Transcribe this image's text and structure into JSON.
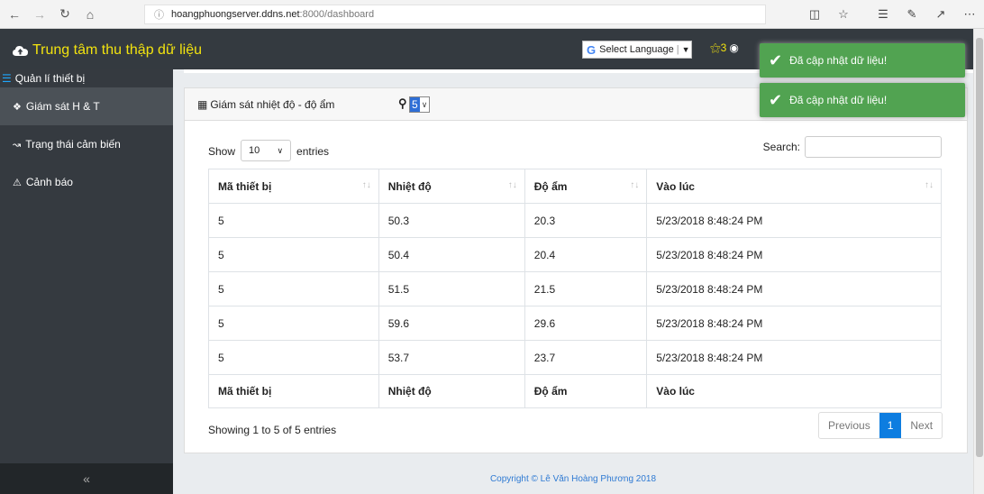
{
  "browser": {
    "url_host": "hoangphuongserver.ddns.net",
    "url_path": ":8000/dashboard"
  },
  "header": {
    "brand": "Trung tâm thu thập dữ liệu",
    "language_label": "Select Language",
    "user_count": "3"
  },
  "sidebar": {
    "section_title": "Quản lí thiết bị",
    "items": [
      {
        "label": "Giám sát H & T"
      },
      {
        "label": "Trạng thái cảm biến"
      },
      {
        "label": "Cảnh báo"
      }
    ],
    "collapse_label": "«"
  },
  "card": {
    "title": "Giám sát nhiệt độ - độ ẩm",
    "device_select_value": "5"
  },
  "table_controls": {
    "show_label": "Show",
    "entries_value": "10",
    "entries_label": "entries",
    "search_label": "Search:"
  },
  "table": {
    "headers": [
      "Mã thiết bị",
      "Nhiệt độ",
      "Độ ẩm",
      "Vào lúc"
    ],
    "rows": [
      [
        "5",
        "50.3",
        "20.3",
        "5/23/2018 8:48:24 PM"
      ],
      [
        "5",
        "50.4",
        "20.4",
        "5/23/2018 8:48:24 PM"
      ],
      [
        "5",
        "51.5",
        "21.5",
        "5/23/2018 8:48:24 PM"
      ],
      [
        "5",
        "59.6",
        "29.6",
        "5/23/2018 8:48:24 PM"
      ],
      [
        "5",
        "53.7",
        "23.7",
        "5/23/2018 8:48:24 PM"
      ]
    ]
  },
  "pagination": {
    "info": "Showing 1 to 5 of 5 entries",
    "previous": "Previous",
    "current": "1",
    "next": "Next"
  },
  "footer": {
    "copyright": "Copyright © Lê Văn Hoàng Phương 2018"
  },
  "toasts": [
    {
      "message": "Đã cập nhật dữ liệu!"
    },
    {
      "message": "Đã cập nhật dữ liệu!"
    }
  ]
}
